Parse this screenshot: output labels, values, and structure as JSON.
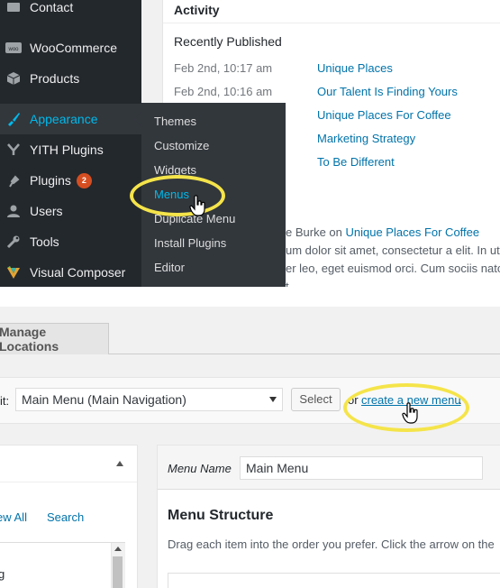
{
  "sidebar": {
    "items": [
      {
        "label": "Contact",
        "icon": "contact-icon"
      },
      {
        "label": "WooCommerce",
        "icon": "woocommerce-icon"
      },
      {
        "label": "Products",
        "icon": "products-icon"
      },
      {
        "label": "Appearance",
        "icon": "appearance-icon"
      },
      {
        "label": "YITH Plugins",
        "icon": "yith-icon"
      },
      {
        "label": "Plugins",
        "icon": "plugins-icon",
        "badge": "2"
      },
      {
        "label": "Users",
        "icon": "users-icon"
      },
      {
        "label": "Tools",
        "icon": "tools-icon"
      },
      {
        "label": "Visual Composer",
        "icon": "visual-composer-icon"
      }
    ],
    "submenu": [
      "Themes",
      "Customize",
      "Widgets",
      "Menus",
      "Duplicate Menu",
      "Install Plugins",
      "Editor"
    ]
  },
  "activity": {
    "title": "Activity",
    "recent_heading": "Recently Published",
    "posts": [
      {
        "date": "Feb 2nd, 10:17 am",
        "title": "Unique Places"
      },
      {
        "date": "Feb 2nd, 10:16 am",
        "title": "Our Talent Is Finding Yours"
      },
      {
        "title": "Unique Places For Coffee"
      },
      {
        "title": "Marketing Strategy"
      },
      {
        "title": "To Be Different"
      }
    ],
    "comment_author_fragment": "e Burke on",
    "comment_post_link": "Unique Places For Coffee",
    "comment_line2": "um dolor sit amet, consectetur a elit. In ut",
    "comment_line3": "er leo, eget euismod orci. Cum sociis nato",
    "comment_line4": "t"
  },
  "menus_page": {
    "tab_manage_locations": "Manage Locations",
    "select_label": "it:",
    "selected_menu": "Main Menu (Main Navigation)",
    "select_button": "Select",
    "or_text": "or",
    "create_link": "create a new menu",
    "period": ".",
    "view_all": "ew All",
    "search_tab": "Search",
    "list_fragment": "g",
    "menu_name_label": "Menu Name",
    "menu_name_value": "Main Menu",
    "menu_structure_title": "Menu Structure",
    "menu_structure_desc": "Drag each item into the order you prefer. Click the arrow on the"
  },
  "colors": {
    "sidebar_bg": "#23282d",
    "submenu_bg": "#32373c",
    "active_blue": "#00b9eb",
    "link_blue": "#0073aa",
    "highlight_yellow": "#f5e44a",
    "badge_orange": "#d54e21"
  }
}
